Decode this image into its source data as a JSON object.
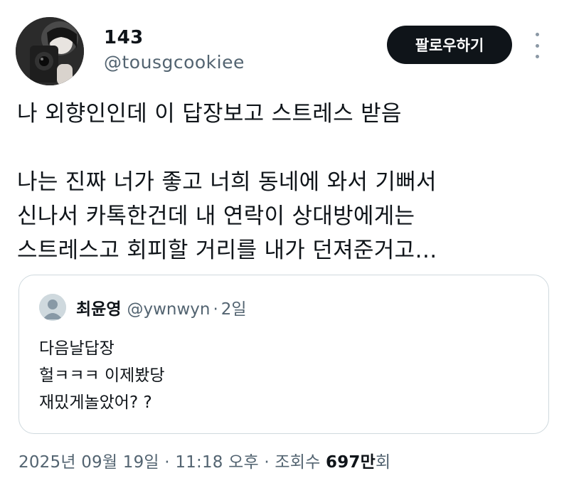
{
  "author": {
    "display_name": "143",
    "handle": "@tousgcookiee",
    "avatar_icon": "profile-photo-icon"
  },
  "follow_button_label": "팔로우하기",
  "more_icon": "more-options-icon",
  "tweet": {
    "text": "나 외향인인데 이 답장보고 스트레스 받음\n\n나는 진짜 너가 좋고 너희 동네에 와서 기뻐서\n신나서 카톡한건데 내 연락이 상대방에게는\n스트레스고 회피할 거리를 내가 던져준거고…"
  },
  "quote": {
    "display_name": "최윤영",
    "handle": "@ywnwyn",
    "separator": "·",
    "time": "2일",
    "avatar_icon": "default-avatar-icon",
    "text": "다음날답장\n헐ㅋㅋㅋ 이제봤당\n재밌게놀았어? ?"
  },
  "meta": {
    "date": "2025년 09월 19일",
    "sep1": "·",
    "time": "11:18 오후",
    "sep2": "·",
    "views_label": "조회수",
    "views_count": "697만",
    "views_suffix": "회"
  },
  "colors": {
    "text": "#0f1419",
    "secondary": "#536471",
    "border": "#cfd9de",
    "button_bg": "#0f1419"
  }
}
